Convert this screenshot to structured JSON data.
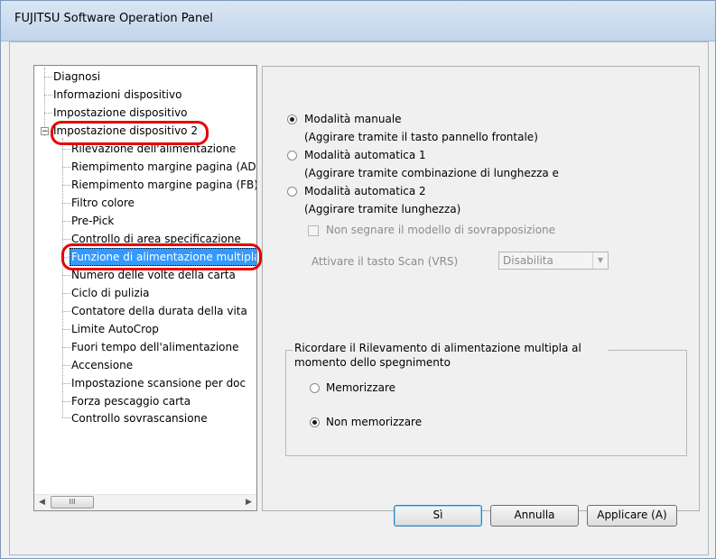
{
  "window": {
    "title": "FUJITSU Software Operation Panel"
  },
  "tree": {
    "top_items": [
      {
        "label": "Diagnosi"
      },
      {
        "label": "Informazioni dispositivo"
      },
      {
        "label": "Impostazione dispositivo"
      },
      {
        "label": "Impostazione dispositivo 2",
        "expanded": true
      }
    ],
    "children": [
      {
        "label": "Rilevazione dell'alimentazione"
      },
      {
        "label": "Riempimento margine pagina (ADF)"
      },
      {
        "label": "Riempimento margine pagina (FB)"
      },
      {
        "label": "Filtro colore"
      },
      {
        "label": "Pre-Pick"
      },
      {
        "label": "Controllo di area specificazione"
      },
      {
        "label": "Funzione di alimentazione multipla",
        "selected": true
      },
      {
        "label": "Numero delle volte della carta"
      },
      {
        "label": "Ciclo di pulizia"
      },
      {
        "label": "Contatore della durata della vita"
      },
      {
        "label": "Limite AutoCrop"
      },
      {
        "label": "Fuori tempo dell'alimentazione"
      },
      {
        "label": "Accensione"
      },
      {
        "label": "Impostazione scansione per doc"
      },
      {
        "label": "Forza pescaggio carta"
      },
      {
        "label": "Controllo sovrascansione"
      }
    ],
    "scrollbar": {
      "thumb_glyph": "III"
    }
  },
  "settings": {
    "modes": [
      {
        "label": "Modalità manuale",
        "description": "(Aggirare tramite il tasto pannello frontale)",
        "checked": true
      },
      {
        "label": "Modalità automatica 1",
        "description": "(Aggirare tramite combinazione di lunghezza e",
        "checked": false
      },
      {
        "label": "Modalità automatica 2",
        "description": "(Aggirare tramite lunghezza)",
        "checked": false
      }
    ],
    "no_mark_checkbox": {
      "label": "Non segnare il modello di sovrapposizione",
      "checked": false,
      "enabled": false
    },
    "scan_button": {
      "label": "Attivare il tasto Scan (VRS)",
      "value": "Disabilita",
      "enabled": false
    },
    "remember_group": {
      "caption": "Ricordare il Rilevamento di alimentazione multipla al momento dello spegnimento",
      "options": [
        {
          "label": "Memorizzare",
          "checked": false
        },
        {
          "label": "Non memorizzare",
          "checked": true
        }
      ]
    }
  },
  "buttons": {
    "yes": "Sì",
    "cancel": "Annulla",
    "apply": "Applicare (A)"
  },
  "annotation_color": "#e60000"
}
